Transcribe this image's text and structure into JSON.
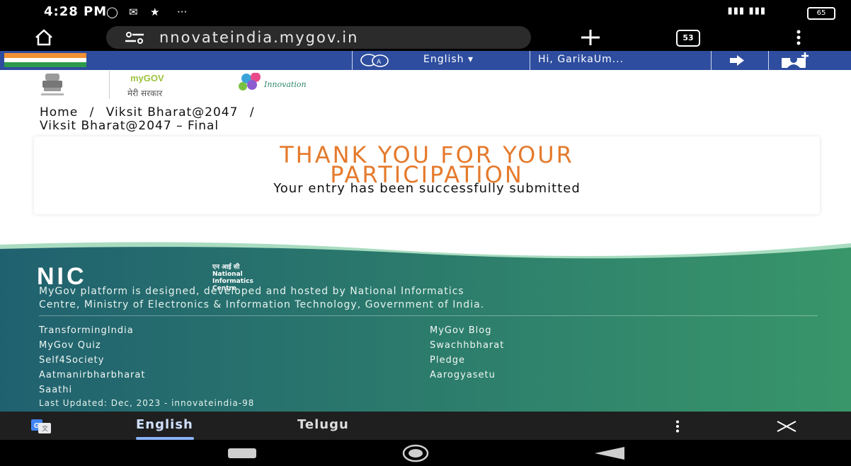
{
  "status_bar": {
    "time": "4:28 PM",
    "battery": "65"
  },
  "browser": {
    "url": "nnovateindia.mygov.in",
    "tab_count": "53"
  },
  "top_nav": {
    "language": "English",
    "greeting": "Hi, GarikaUm..."
  },
  "logo": {
    "mygov_text": "myGOV",
    "tagline": "मेरी सरकार",
    "innovation": "Innovation"
  },
  "breadcrumb": {
    "home": "Home",
    "sep": "/",
    "level1": "Viksit Bharat@2047",
    "level2": "Viksit Bharat@2047 – Final"
  },
  "confirmation": {
    "title_line1": "THANK YOU FOR YOUR",
    "title_line2": "PARTICIPATION",
    "subtitle": "Your entry has been successfully submitted"
  },
  "footer": {
    "nic_hindi": "एन आई सी",
    "nic_name_1": "National",
    "nic_name_2": "Informatics",
    "nic_name_3": "Centre",
    "description_line1": "MyGov platform is designed, developed and hosted by National Informatics",
    "description_line2": "Centre, Ministry of Electronics & Information Technology, Government of India.",
    "links_left": [
      "TransformingIndia",
      "MyGov Quiz",
      "Self4Society",
      "Aatmanirbharbharat",
      "Saathi"
    ],
    "links_right": [
      "MyGov Blog",
      "Swachhbharat",
      "Pledge",
      "Aarogyasetu"
    ],
    "last_updated": "Last Updated: Dec, 2023 - innovateindia-98"
  },
  "translate_bar": {
    "lang_selected": "English",
    "lang_other": "Telugu"
  },
  "colors": {
    "nav_blue": "#2e4d9f",
    "accent_orange": "#e57a2c",
    "footer_green": "#2f8a6b"
  }
}
